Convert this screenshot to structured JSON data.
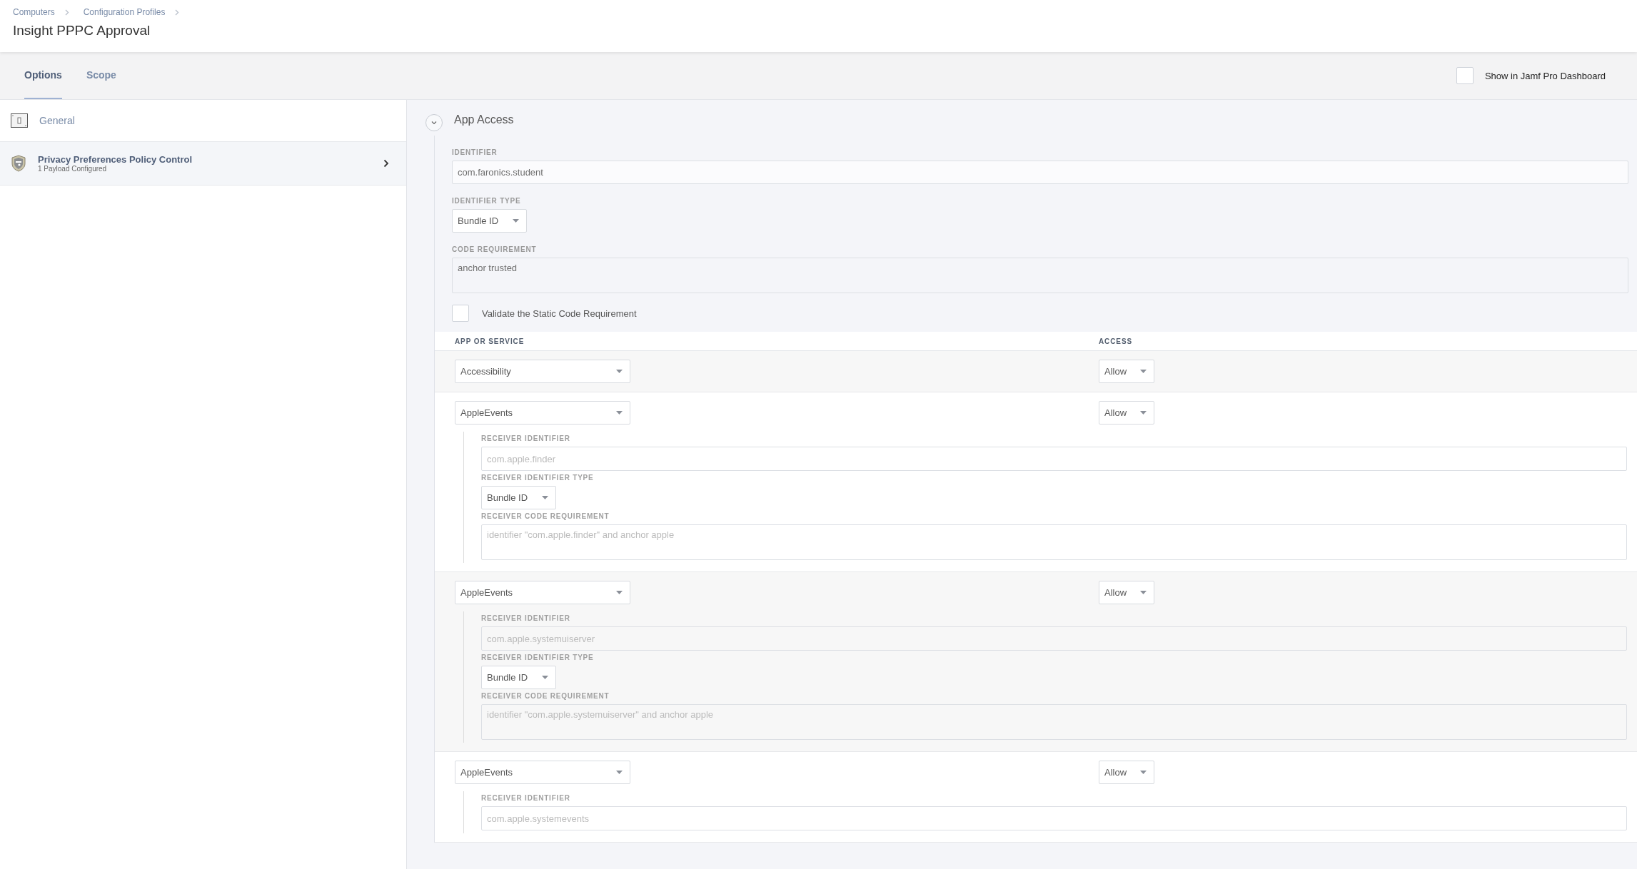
{
  "breadcrumbs": [
    {
      "label": "Computers"
    },
    {
      "label": "Configuration Profiles"
    }
  ],
  "title": "Insight PPPC Approval",
  "tabs": [
    {
      "label": "Options",
      "selected": true
    },
    {
      "label": "Scope",
      "selected": false
    }
  ],
  "dashboard": {
    "label": "Show in Jamf Pro Dashboard",
    "checked": false
  },
  "sidebar": {
    "items": [
      {
        "kind": "general",
        "label": "General",
        "selected": false
      },
      {
        "kind": "shield",
        "label": "Privacy Preferences Policy Control",
        "subtitle": "1 Payload Configured",
        "selected": true
      }
    ]
  },
  "section": {
    "title": "App Access",
    "expanded": true,
    "identifier": {
      "label": "IDENTIFIER",
      "value": "com.faronics.student"
    },
    "identifier_type": {
      "label": "IDENTIFIER TYPE",
      "value": "Bundle ID"
    },
    "code_requirement": {
      "label": "CODE REQUIREMENT",
      "value": "anchor trusted"
    },
    "validate": {
      "label": "Validate the Static Code Requirement",
      "checked": false
    },
    "table": {
      "columns": [
        "APP OR SERVICE",
        "ACCESS"
      ],
      "rows": [
        {
          "service": "Accessibility",
          "access": "Allow"
        },
        {
          "service": "AppleEvents",
          "access": "Allow",
          "receiver": {
            "identifier_label": "RECEIVER IDENTIFIER",
            "identifier": "com.apple.finder",
            "type_label": "RECEIVER IDENTIFIER TYPE",
            "type": "Bundle ID",
            "code_label": "RECEIVER CODE REQUIREMENT",
            "code": "identifier \"com.apple.finder\" and anchor apple"
          }
        },
        {
          "service": "AppleEvents",
          "access": "Allow",
          "receiver": {
            "identifier_label": "RECEIVER IDENTIFIER",
            "identifier": "com.apple.systemuiserver",
            "type_label": "RECEIVER IDENTIFIER TYPE",
            "type": "Bundle ID",
            "code_label": "RECEIVER CODE REQUIREMENT",
            "code": "identifier \"com.apple.systemuiserver\" and anchor apple"
          }
        },
        {
          "service": "AppleEvents",
          "access": "Allow",
          "receiver": {
            "identifier_label": "RECEIVER IDENTIFIER",
            "identifier": "com.apple.systemevents"
          }
        }
      ]
    }
  }
}
